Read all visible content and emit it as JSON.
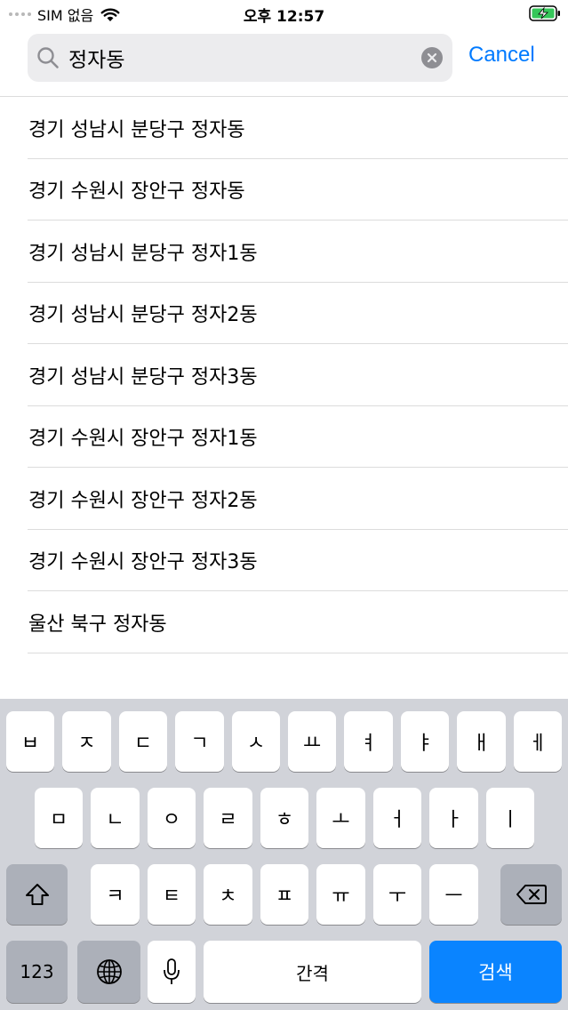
{
  "status_bar": {
    "carrier": "SIM 없음",
    "time": "오후 12:57"
  },
  "search": {
    "value": "정자동",
    "cancel_label": "Cancel"
  },
  "results": [
    "경기 성남시 분당구 정자동",
    "경기 수원시 장안구 정자동",
    "경기 성남시 분당구 정자1동",
    "경기 성남시 분당구 정자2동",
    "경기 성남시 분당구 정자3동",
    "경기 수원시 장안구 정자1동",
    "경기 수원시 장안구 정자2동",
    "경기 수원시 장안구 정자3동",
    "울산 북구 정자동"
  ],
  "keyboard": {
    "row1": [
      "ㅂ",
      "ㅈ",
      "ㄷ",
      "ㄱ",
      "ㅅ",
      "ㅛ",
      "ㅕ",
      "ㅑ",
      "ㅐ",
      "ㅔ"
    ],
    "row2": [
      "ㅁ",
      "ㄴ",
      "ㅇ",
      "ㄹ",
      "ㅎ",
      "ㅗ",
      "ㅓ",
      "ㅏ",
      "ㅣ"
    ],
    "row3": [
      "ㅋ",
      "ㅌ",
      "ㅊ",
      "ㅍ",
      "ㅠ",
      "ㅜ",
      "ㅡ"
    ],
    "numbers_label": "123",
    "space_label": "간격",
    "search_label": "검색",
    "icons": {
      "shift": "shift-icon",
      "delete": "backspace-icon",
      "globe": "globe-icon",
      "mic": "microphone-icon"
    }
  },
  "colors": {
    "accent": "#007aff",
    "search_key": "#0a84ff",
    "keyboard_bg": "#d1d3d9",
    "battery_charging": "#34c759"
  }
}
